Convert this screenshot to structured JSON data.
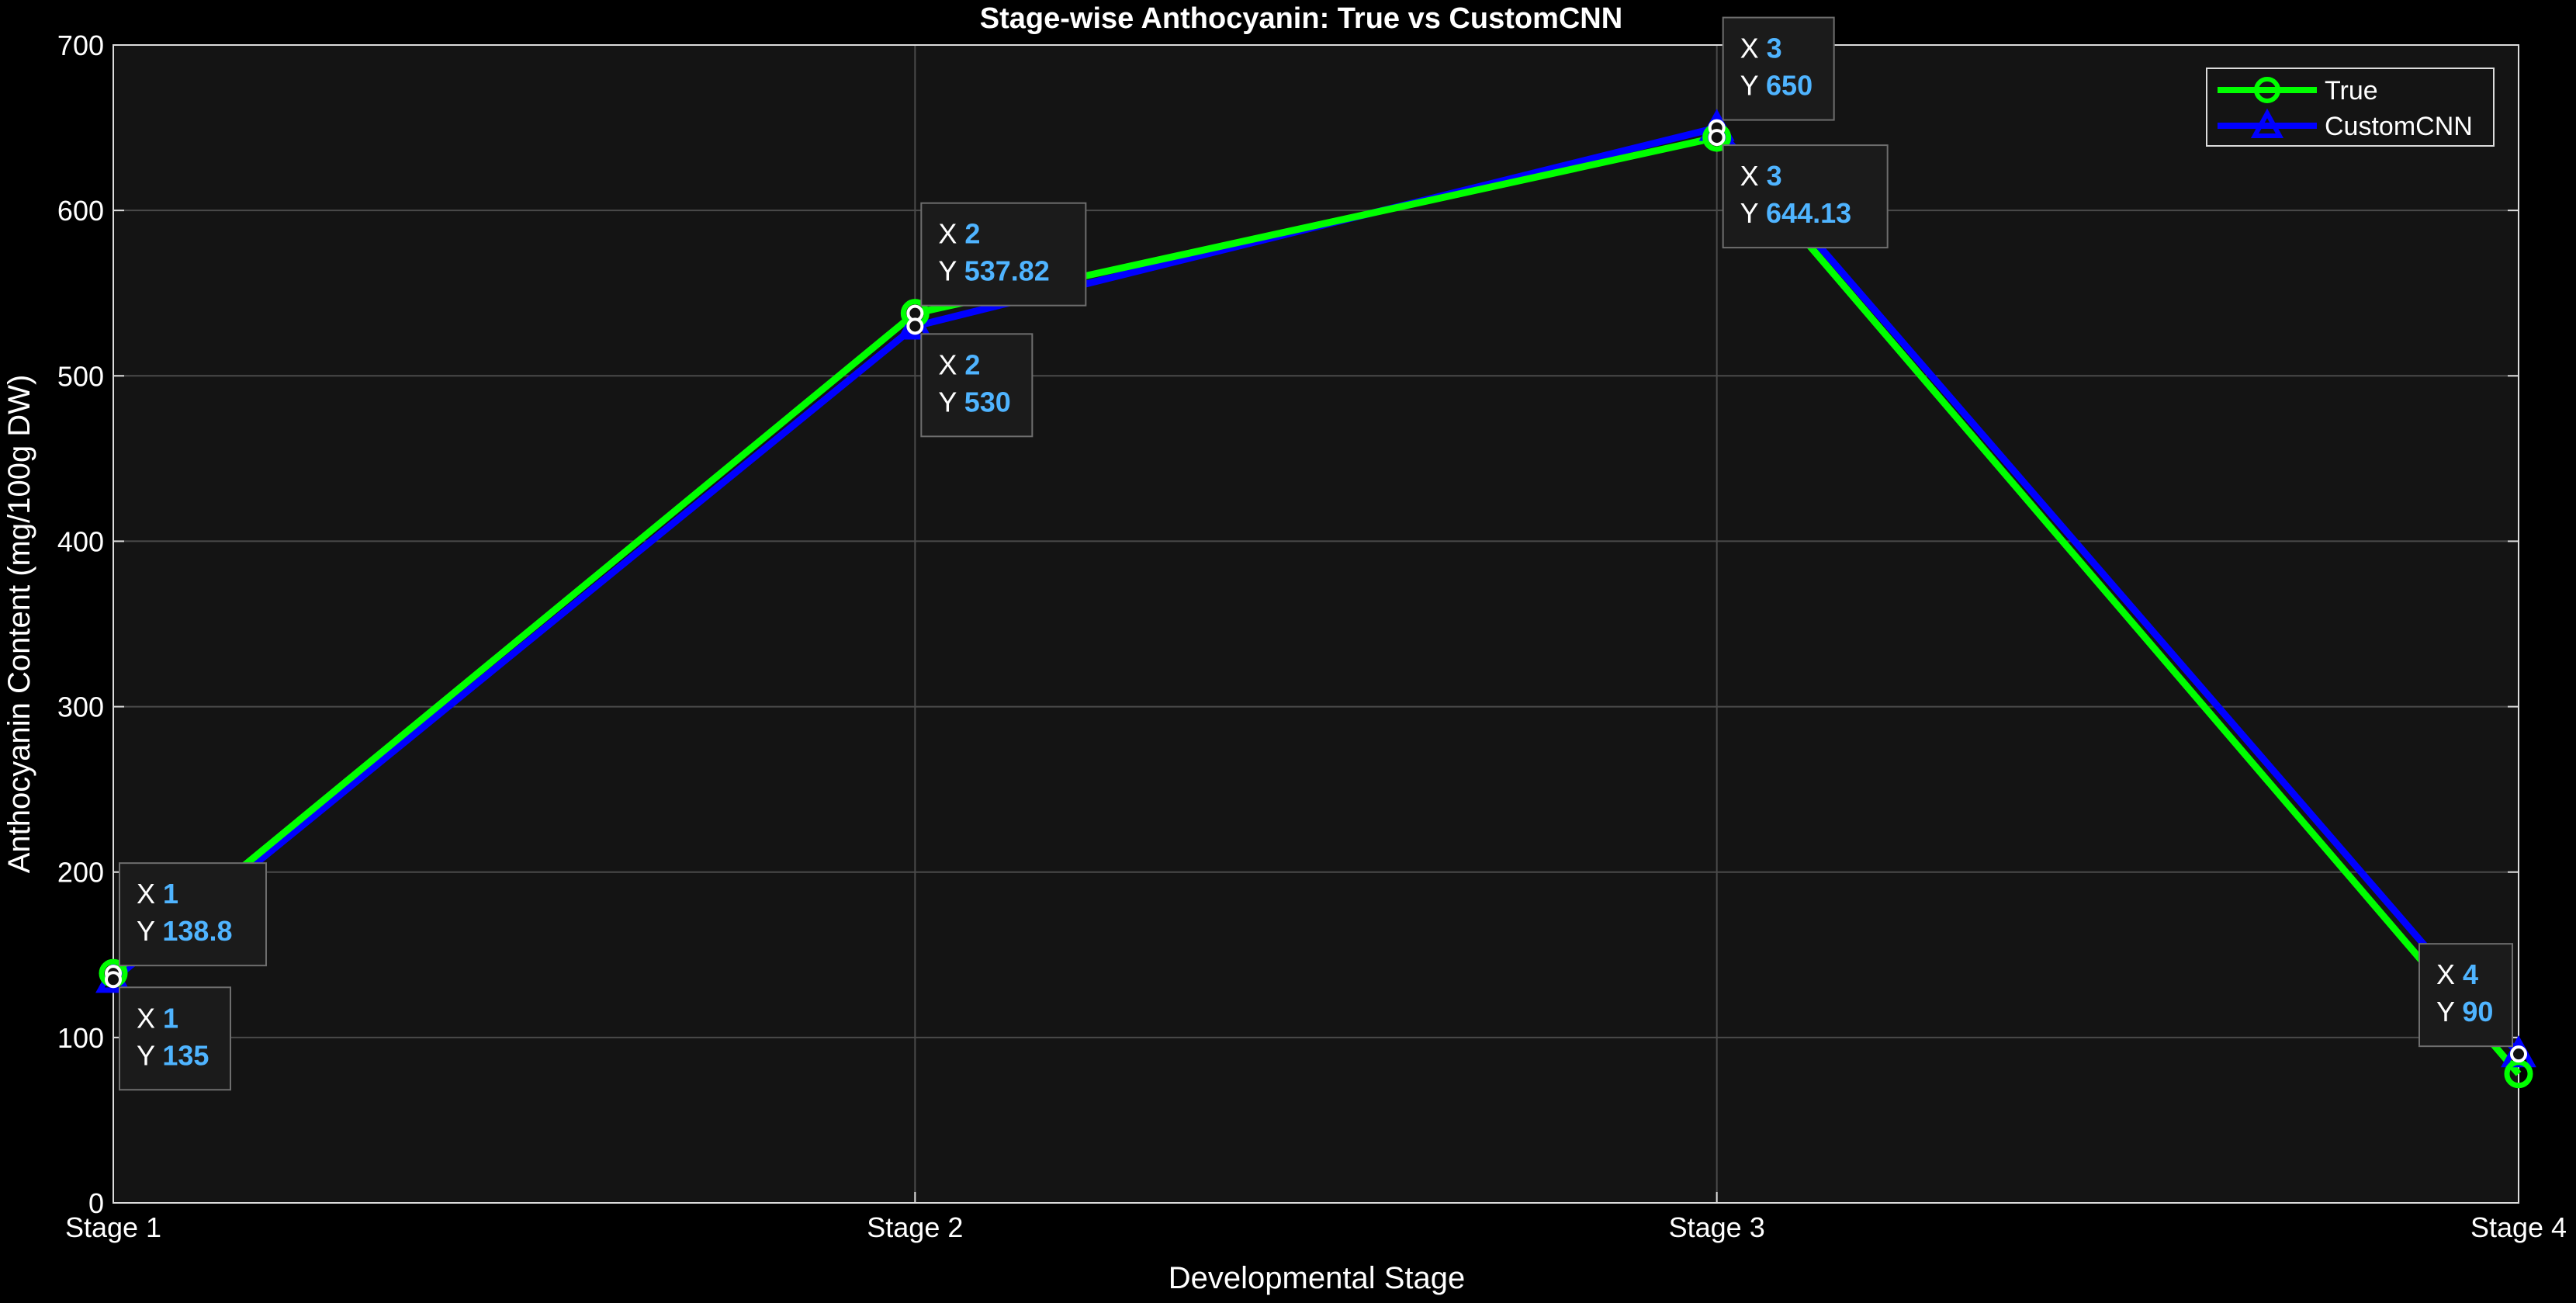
{
  "chart_data": {
    "type": "line",
    "title": "Stage-wise Anthocyanin: True vs CustomCNN",
    "xlabel": "Developmental Stage",
    "ylabel": "Anthocyanin Content (mg/100g DW)",
    "x": [
      1,
      2,
      3,
      4
    ],
    "x_tick_labels": [
      "Stage 1",
      "Stage 2",
      "Stage 3",
      "Stage 4"
    ],
    "xlim": [
      1,
      4
    ],
    "ylim": [
      0,
      700
    ],
    "y_ticks": [
      0,
      100,
      200,
      300,
      400,
      500,
      600,
      700
    ],
    "grid": true,
    "legend_position": "top-right",
    "series": [
      {
        "name": "True",
        "values": [
          138.8,
          537.82,
          644.13,
          78
        ],
        "color": "#00ff00",
        "marker": "circle"
      },
      {
        "name": "CustomCNN",
        "values": [
          135,
          530,
          650,
          90
        ],
        "color": "#0000ff",
        "marker": "triangle"
      }
    ],
    "datatips": [
      {
        "series": "True",
        "x": 1,
        "x_text": "1",
        "y_text": "138.8",
        "placement": "above-right"
      },
      {
        "series": "CustomCNN",
        "x": 1,
        "x_text": "1",
        "y_text": "135",
        "placement": "below-right"
      },
      {
        "series": "True",
        "x": 2,
        "x_text": "2",
        "y_text": "537.82",
        "placement": "above-right"
      },
      {
        "series": "CustomCNN",
        "x": 2,
        "x_text": "2",
        "y_text": "530",
        "placement": "below-right"
      },
      {
        "series": "CustomCNN",
        "x": 3,
        "x_text": "3",
        "y_text": "650",
        "placement": "above-right"
      },
      {
        "series": "True",
        "x": 3,
        "x_text": "3",
        "y_text": "644.13",
        "placement": "below-right"
      },
      {
        "series": "CustomCNN",
        "x": 4,
        "x_text": "4",
        "y_text": "90",
        "placement": "above-left"
      }
    ],
    "colors": {
      "figure_background": "#000000",
      "axes_background": "#141414",
      "grid": "#4a4a4a",
      "text": "#ffffff",
      "datatip_value": "#4fb4ff"
    }
  }
}
